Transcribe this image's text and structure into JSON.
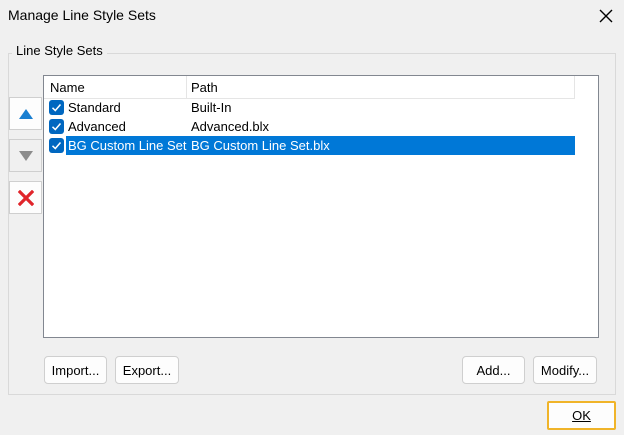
{
  "window": {
    "title": "Manage Line Style Sets"
  },
  "group": {
    "label": "Line Style Sets"
  },
  "list": {
    "columns": [
      "Name",
      "Path"
    ],
    "rows": [
      {
        "name": "Standard",
        "path": "Built-In",
        "checked": true,
        "selected": false
      },
      {
        "name": "Advanced",
        "path": "Advanced.blx",
        "checked": true,
        "selected": false
      },
      {
        "name": "BG Custom Line Set",
        "path": "BG Custom Line Set.blx",
        "checked": true,
        "selected": true
      }
    ]
  },
  "buttons": {
    "import": "Import...",
    "export": "Export...",
    "add": "Add...",
    "modify": "Modify...",
    "ok": "OK"
  },
  "icons": {
    "move_up": "triangle-up-icon",
    "move_down": "triangle-down-icon",
    "delete": "red-x-icon",
    "close": "close-icon"
  },
  "colors": {
    "selection": "#0078d7",
    "checkbox": "#0067c0",
    "up_arrow": "#1a7fd1",
    "delete": "#e0242a",
    "ok_focus_border": "#f0b429"
  }
}
